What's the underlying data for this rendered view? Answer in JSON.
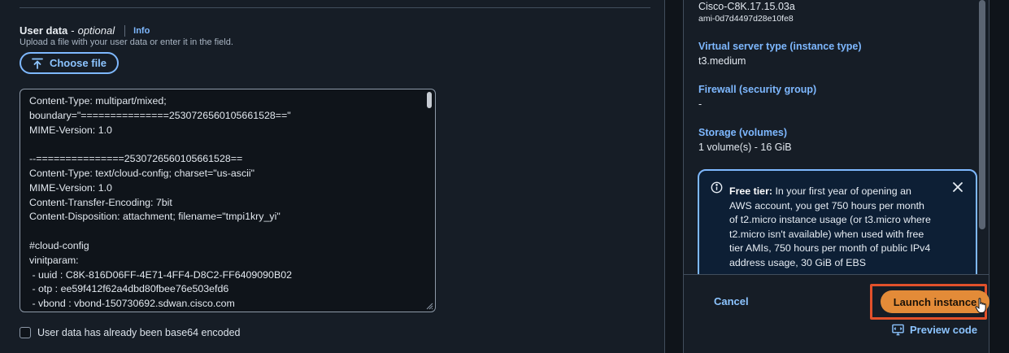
{
  "user_data": {
    "label": "User data",
    "dash": "-",
    "optional": "optional",
    "info": "Info",
    "description": "Upload a file with your user data or enter it in the field.",
    "choose_file": "Choose file",
    "content": "Content-Type: multipart/mixed;\nboundary=\"===============2530726560105661528==\"\nMIME-Version: 1.0\n\n--===============2530726560105661528==\nContent-Type: text/cloud-config; charset=\"us-ascii\"\nMIME-Version: 1.0\nContent-Transfer-Encoding: 7bit\nContent-Disposition: attachment; filename=\"tmpi1kry_yi\"\n\n#cloud-config\nvinitparam:\n - uuid : C8K-816D06FF-4E71-4FF4-D8C2-FF6409090B02\n - otp : ee59f412f62a4dbd80fbee76e503efd6\n - vbond : vbond-150730692.sdwan.cisco.com",
    "base64_label": "User data has already been base64 encoded",
    "base64_checked": false
  },
  "summary": {
    "ami_name": "Cisco-C8K.17.15.03a",
    "ami_id": "ami-0d7d4497d28e10fe8",
    "instance_type_label": "Virtual server type (instance type)",
    "instance_type_value": "t3.medium",
    "firewall_label": "Firewall (security group)",
    "firewall_value": "-",
    "storage_label": "Storage (volumes)",
    "storage_value": "1 volume(s) - 16 GiB",
    "free_tier_title": "Free tier:",
    "free_tier_text": "In your first year of opening an AWS account, you get 750 hours per month of t2.micro instance usage (or t3.micro where t2.micro isn't available) when used with free tier AMIs, 750 hours per month of public IPv4 address usage, 30 GiB of EBS"
  },
  "footer": {
    "cancel": "Cancel",
    "launch": "Launch instance",
    "preview": "Preview code"
  },
  "colors": {
    "accent": "#7eb8ff",
    "primary_button": "#e38b38",
    "highlight_box": "#e2512b"
  },
  "icons": {
    "upload": "upload-icon",
    "info": "info-circle-icon",
    "close": "close-icon",
    "preview": "code-preview-icon",
    "cursor": "hand-pointer-icon"
  }
}
